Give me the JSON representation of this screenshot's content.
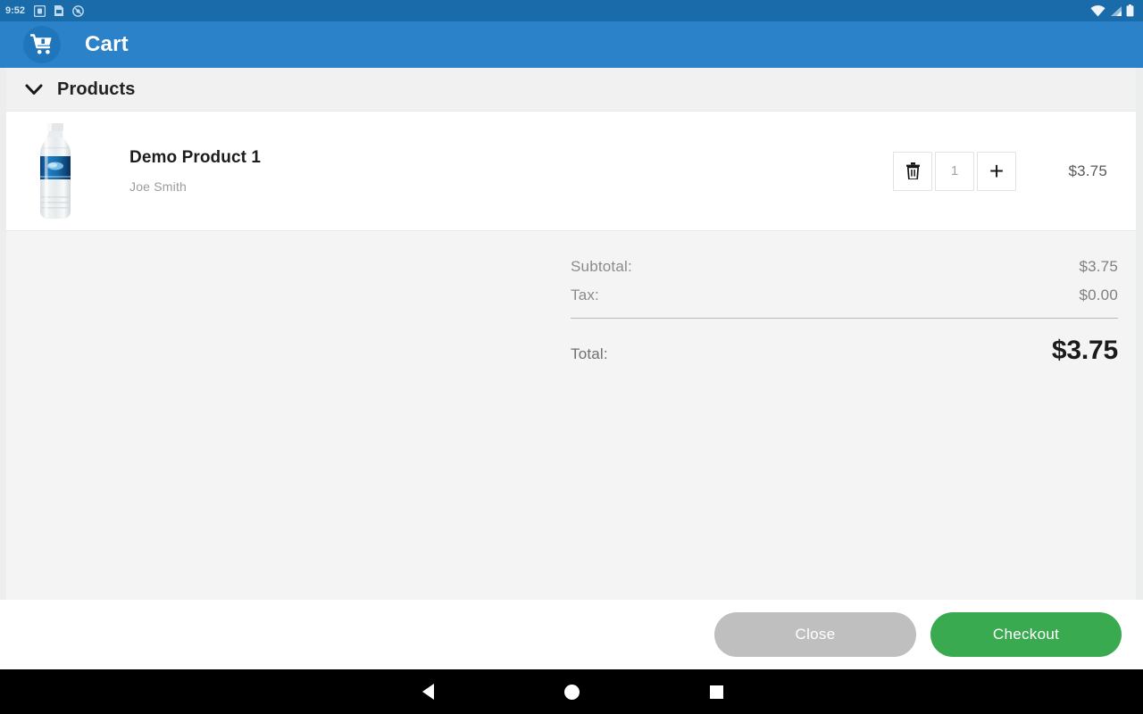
{
  "statusbar": {
    "time": "9:52",
    "left_icons": [
      "sd-card-icon",
      "sim-card-icon",
      "no-entry-icon"
    ],
    "right_icons": [
      "wifi-icon",
      "signal-icon",
      "battery-icon"
    ],
    "background_color": "#1a6baa"
  },
  "appbar": {
    "title": "Cart",
    "icon": "shopping-cart-icon",
    "background_color": "#2b82c8",
    "badge_color": "#2076bb"
  },
  "section": {
    "title": "Products",
    "expand_icon": "chevron-down-icon",
    "expanded": true
  },
  "products": [
    {
      "name": "Demo Product 1",
      "seller": "Joe Smith",
      "image": "water-bottle-image",
      "quantity": "1",
      "price": "$3.75",
      "remove_icon": "trash-icon",
      "increment_label": "+"
    }
  ],
  "totals": {
    "subtotal_label": "Subtotal:",
    "subtotal_value": "$3.75",
    "tax_label": "Tax:",
    "tax_value": "$0.00",
    "total_label": "Total:",
    "total_value": "$3.75"
  },
  "footer": {
    "close_label": "Close",
    "close_color": "#bfbfbf",
    "checkout_label": "Checkout",
    "checkout_color": "#3aaa50"
  },
  "navbar": {
    "back": "back-triangle-icon",
    "home": "home-circle-icon",
    "recents": "recents-square-icon"
  }
}
